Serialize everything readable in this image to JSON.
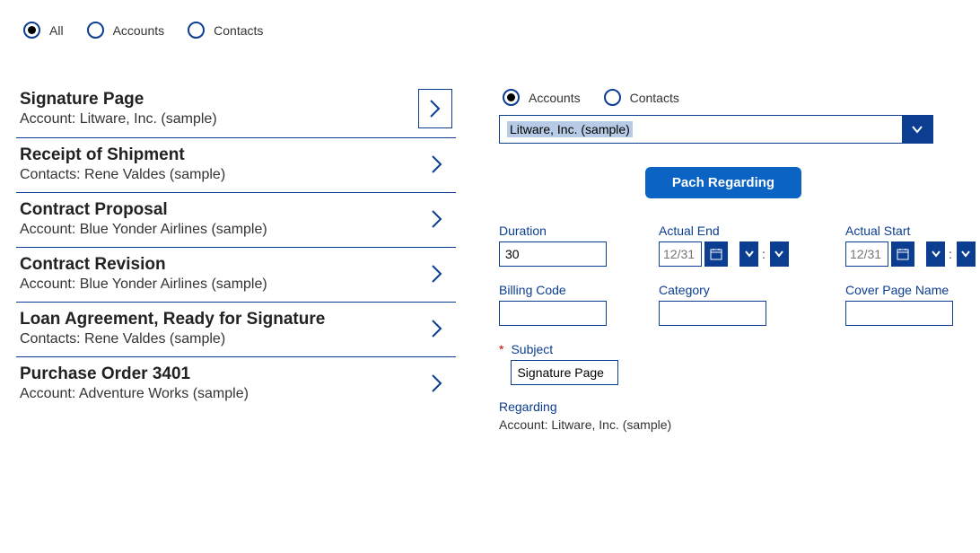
{
  "filter": {
    "options": [
      "All",
      "Accounts",
      "Contacts"
    ],
    "selected": 0
  },
  "list": [
    {
      "title": "Signature Page",
      "sub": "Account: Litware, Inc. (sample)"
    },
    {
      "title": "Receipt of Shipment",
      "sub": "Contacts: Rene Valdes (sample)"
    },
    {
      "title": "Contract Proposal",
      "sub": "Account: Blue Yonder Airlines (sample)"
    },
    {
      "title": "Contract Revision",
      "sub": "Account: Blue Yonder Airlines (sample)"
    },
    {
      "title": "Loan Agreement, Ready for Signature",
      "sub": "Contacts: Rene Valdes (sample)"
    },
    {
      "title": "Purchase Order 3401",
      "sub": "Account: Adventure Works (sample)"
    }
  ],
  "detail": {
    "filter": {
      "options": [
        "Accounts",
        "Contacts"
      ],
      "selected": 0
    },
    "combobox_value": "Litware, Inc. (sample)",
    "button_label": "Pach Regarding",
    "fields": {
      "duration": {
        "label": "Duration",
        "value": "30"
      },
      "actual_end": {
        "label": "Actual End",
        "placeholder": "12/31"
      },
      "actual_start": {
        "label": "Actual Start",
        "placeholder": "12/31"
      },
      "billing_code": {
        "label": "Billing Code",
        "value": ""
      },
      "category": {
        "label": "Category",
        "value": ""
      },
      "cover_page": {
        "label": "Cover Page Name",
        "value": ""
      },
      "subject": {
        "label": "Subject",
        "value": "Signature Page",
        "required": "*"
      },
      "regarding": {
        "label": "Regarding",
        "value": "Account: Litware, Inc. (sample)"
      }
    }
  }
}
